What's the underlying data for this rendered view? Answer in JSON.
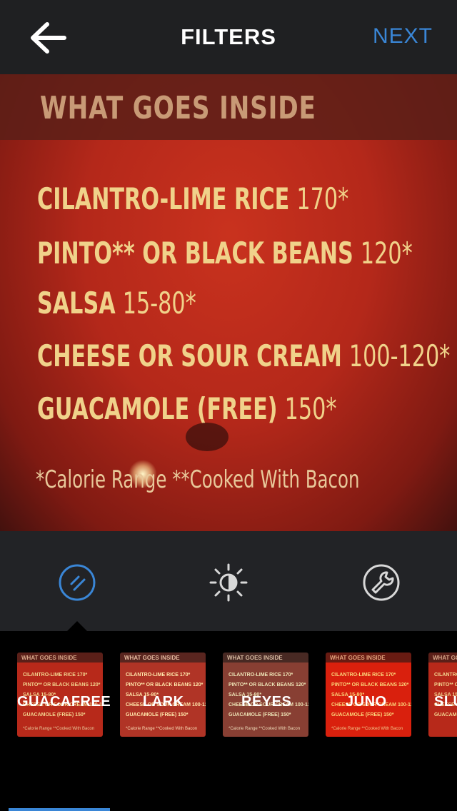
{
  "header": {
    "title": "FILTERS",
    "next_label": "NEXT"
  },
  "photo": {
    "heading": "WHAT GOES INSIDE",
    "lines": [
      {
        "item": "CILANTRO-LIME RICE",
        "cal": "170*"
      },
      {
        "item": "PINTO** OR BLACK BEANS",
        "cal": "120*"
      },
      {
        "item": "SALSA",
        "cal": "15-80*"
      },
      {
        "item": "CHEESE OR SOUR CREAM",
        "cal": "100-120*"
      },
      {
        "item": "GUACAMOLE (FREE)",
        "cal": "150*"
      }
    ],
    "footnote": "*Calorie Range   **Cooked With Bacon"
  },
  "tools": [
    {
      "name": "filter-icon",
      "active": true
    },
    {
      "name": "brightness-icon",
      "active": false
    },
    {
      "name": "wrench-icon",
      "active": false
    }
  ],
  "filters": [
    {
      "label": "GUACAFREE",
      "selected": true
    },
    {
      "label": "LARK",
      "selected": false
    },
    {
      "label": "REYES",
      "selected": false
    },
    {
      "label": "JUNO",
      "selected": false
    },
    {
      "label": "SLU",
      "selected": false
    }
  ],
  "colors": {
    "accent": "#3a86d6",
    "bar": "#1f2022"
  }
}
